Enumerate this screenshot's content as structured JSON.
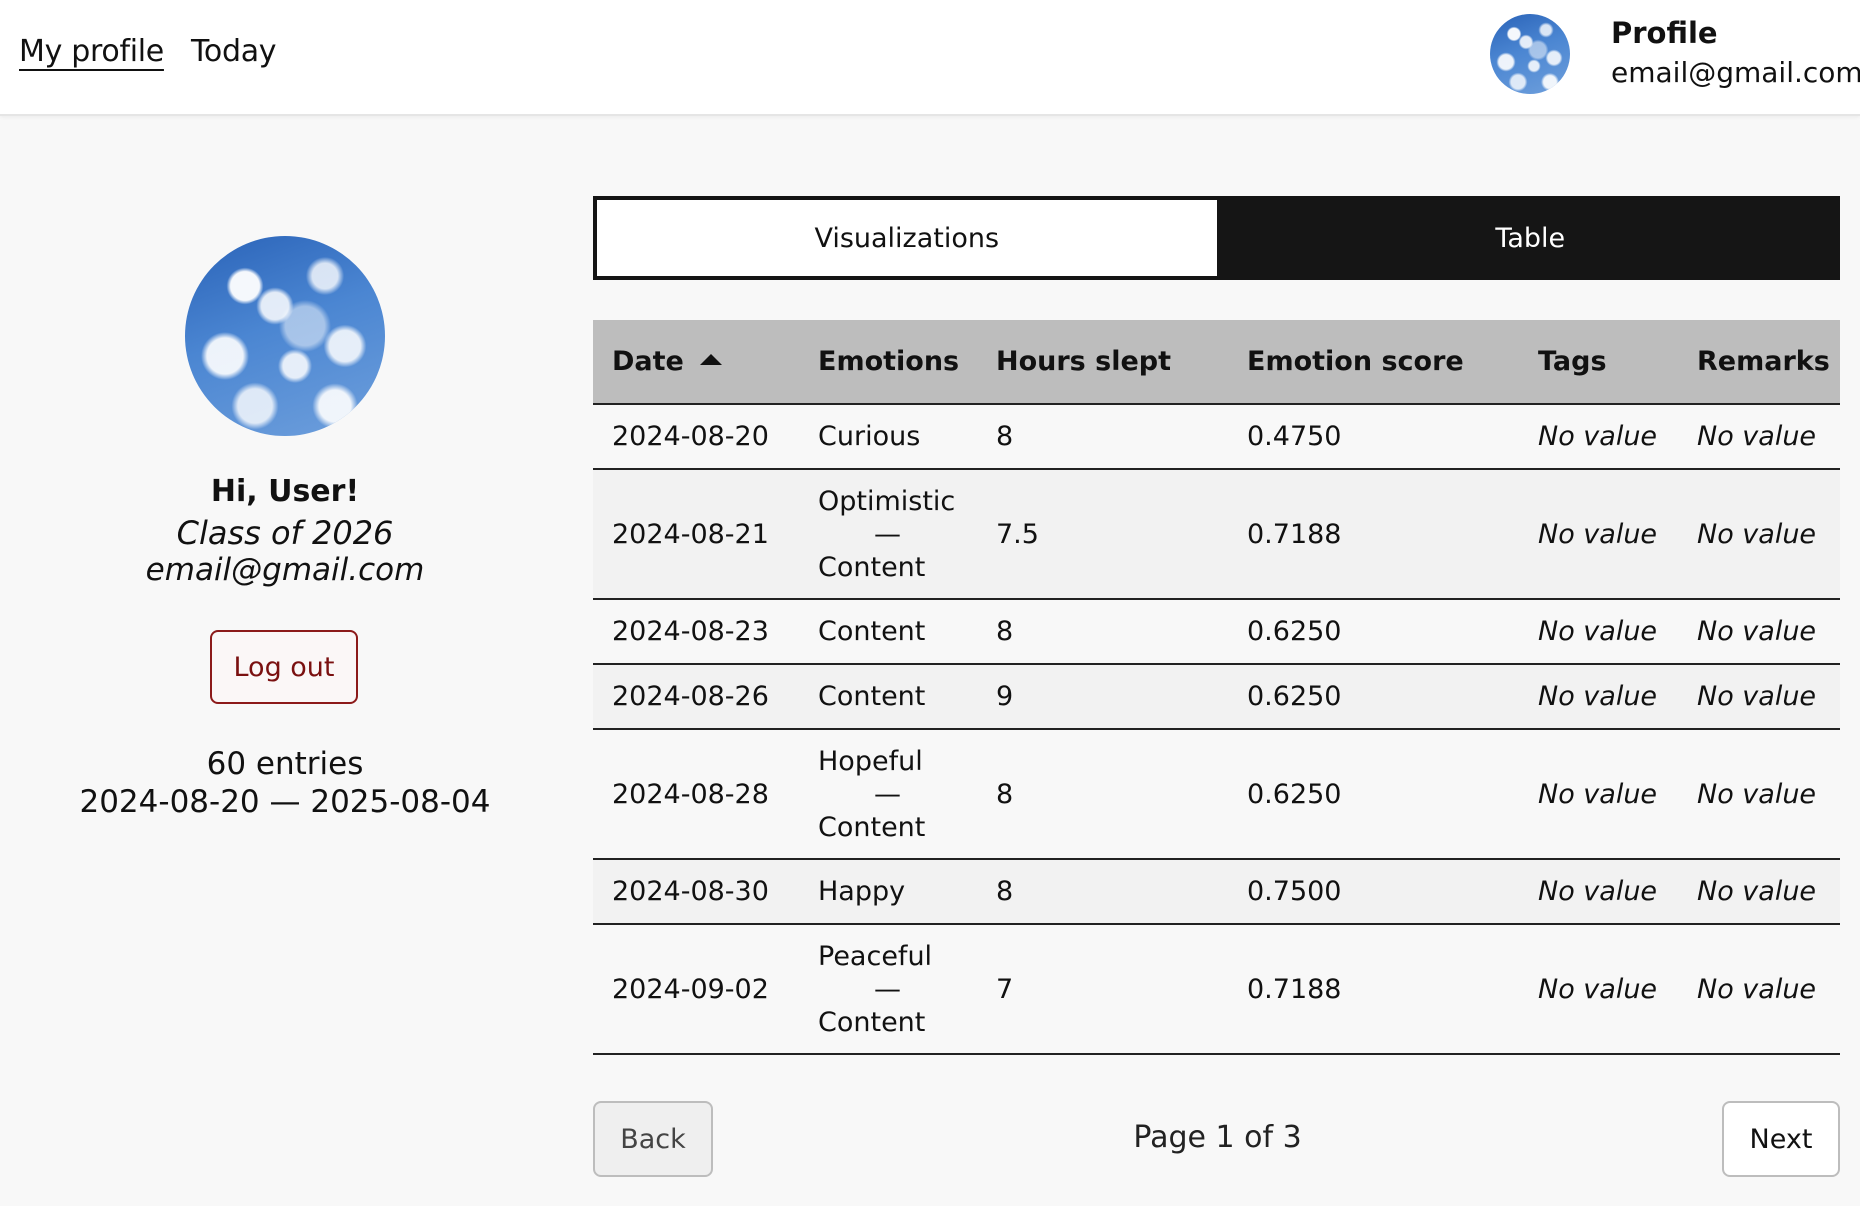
{
  "nav": {
    "my_profile": "My profile",
    "today": "Today",
    "profile_label": "Profile",
    "profile_email": "email@gmail.com"
  },
  "user": {
    "greeting": "Hi, User!",
    "class_year": "Class of 2026",
    "email": "email@gmail.com",
    "logout_label": "Log out",
    "entries": "60 entries",
    "date_range": "2024-08-20 — 2025-08-04"
  },
  "tabs": [
    {
      "label": "Visualizations",
      "active": false
    },
    {
      "label": "Table",
      "active": true
    }
  ],
  "table": {
    "headers": [
      "Date",
      "Emotions",
      "Hours slept",
      "Emotion score",
      "Tags",
      "Remarks"
    ],
    "sort": {
      "column": "Date",
      "direction": "ascending"
    },
    "rows": [
      {
        "date": "2024-08-20",
        "emotions": [
          "Curious"
        ],
        "hours": "8",
        "score": "0.4750",
        "tags": "No value",
        "remarks": "No value"
      },
      {
        "date": "2024-08-21",
        "emotions": [
          "Optimistic",
          "—",
          "Content"
        ],
        "hours": "7.5",
        "score": "0.7188",
        "tags": "No value",
        "remarks": "No value"
      },
      {
        "date": "2024-08-23",
        "emotions": [
          "Content"
        ],
        "hours": "8",
        "score": "0.6250",
        "tags": "No value",
        "remarks": "No value"
      },
      {
        "date": "2024-08-26",
        "emotions": [
          "Content"
        ],
        "hours": "9",
        "score": "0.6250",
        "tags": "No value",
        "remarks": "No value"
      },
      {
        "date": "2024-08-28",
        "emotions": [
          "Hopeful",
          "—",
          "Content"
        ],
        "hours": "8",
        "score": "0.6250",
        "tags": "No value",
        "remarks": "No value"
      },
      {
        "date": "2024-08-30",
        "emotions": [
          "Happy"
        ],
        "hours": "8",
        "score": "0.7500",
        "tags": "No value",
        "remarks": "No value"
      },
      {
        "date": "2024-09-02",
        "emotions": [
          "Peaceful",
          "—",
          "Content"
        ],
        "hours": "7",
        "score": "0.7188",
        "tags": "No value",
        "remarks": "No value"
      }
    ]
  },
  "pagination": {
    "back_label": "Back",
    "next_label": "Next",
    "page_info": "Page 1 of 3"
  },
  "colors": {
    "logout_border": "#8c1a1a",
    "tab_active_bg": "#151515",
    "header_bg": "#bdbdbd"
  },
  "icons": {
    "sort": "sort-ascending-icon",
    "avatar": "sky-avatar-image"
  }
}
